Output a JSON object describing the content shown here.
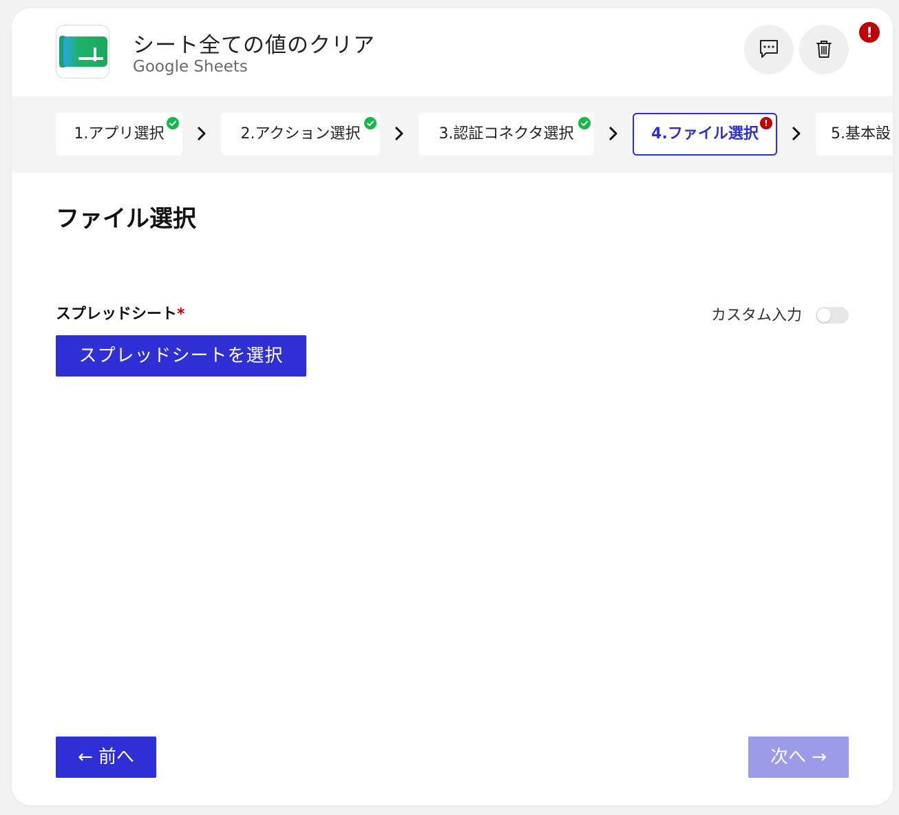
{
  "header": {
    "title": "シート全ての値のクリア",
    "subtitle": "Google Sheets",
    "logo_icon": "google-sheets-logo-icon",
    "comment_icon": "comment-icon",
    "trash_icon": "trash-icon",
    "alert_glyph": "!"
  },
  "steps": [
    {
      "label": "1.アプリ選択",
      "status": "done"
    },
    {
      "label": "2.アクション選択",
      "status": "done"
    },
    {
      "label": "3.認証コネクタ選択",
      "status": "done"
    },
    {
      "label": "4.ファイル選択",
      "status": "error"
    },
    {
      "label": "5.基本設",
      "status": "none"
    }
  ],
  "section": {
    "title": "ファイル選択"
  },
  "field": {
    "label": "スプレッドシート",
    "required_mark": "*",
    "custom_input_label": "カスタム入力",
    "custom_input_enabled": false,
    "select_button": "スプレッドシートを選択"
  },
  "nav": {
    "prev": "← 前へ",
    "next": "次へ →"
  },
  "colors": {
    "accent": "#2f2fd6",
    "accent_disabled": "#9b9bea",
    "success": "#16b84a",
    "error": "#c00000",
    "sheets_green": "#1fa463"
  }
}
